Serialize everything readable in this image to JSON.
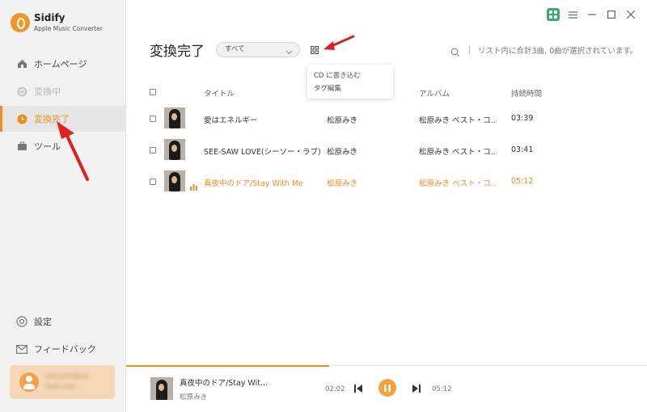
{
  "app": {
    "name": "Sidify",
    "subtitle": "Apple Music Converter"
  },
  "sidebar": {
    "items": [
      {
        "label": "ホームページ",
        "icon": "home-icon",
        "state": "normal"
      },
      {
        "label": "変換中",
        "icon": "sync-icon",
        "state": "disabled"
      },
      {
        "label": "変換完了",
        "icon": "clock-icon",
        "state": "active"
      },
      {
        "label": "ツール",
        "icon": "toolbox-icon",
        "state": "normal"
      }
    ],
    "bottom": [
      {
        "label": "設定",
        "icon": "gear-icon"
      },
      {
        "label": "フィードバック",
        "icon": "mail-icon"
      }
    ],
    "user": {
      "email_line1": "slanyshi@ou",
      "email_line2": "look.com"
    }
  },
  "header": {
    "title": "変換完了",
    "filter": "すべて",
    "status": "リスト内に合計3曲, 0曲が選択されています。"
  },
  "popup": {
    "items": [
      "CD に書き込む",
      "タグ編集"
    ]
  },
  "table": {
    "columns": [
      "タイトル",
      "アルバム",
      "持続時間"
    ],
    "rows": [
      {
        "title": "愛はエネルギー",
        "artist": "松原みき",
        "album": "松原みき ベスト・コ...",
        "duration": "03:39",
        "playing": false
      },
      {
        "title": "SEE-SAW LOVE(シーソー・ラブ)",
        "artist": "松原みき",
        "album": "松原みき ベスト・コ...",
        "duration": "03:41",
        "playing": false
      },
      {
        "title": "真夜中のドア/Stay With Me",
        "artist": "松原みき",
        "album": "松原みき ベスト・コ...",
        "duration": "05:12",
        "playing": true
      }
    ]
  },
  "player": {
    "title": "真夜中のドア/Stay Wit...",
    "artist": "松原みき",
    "elapsed": "02:02",
    "total": "05:12",
    "progress_fraction": 0.39
  },
  "colors": {
    "accent": "#f08c1e",
    "grid_active": "#3fa66d"
  }
}
